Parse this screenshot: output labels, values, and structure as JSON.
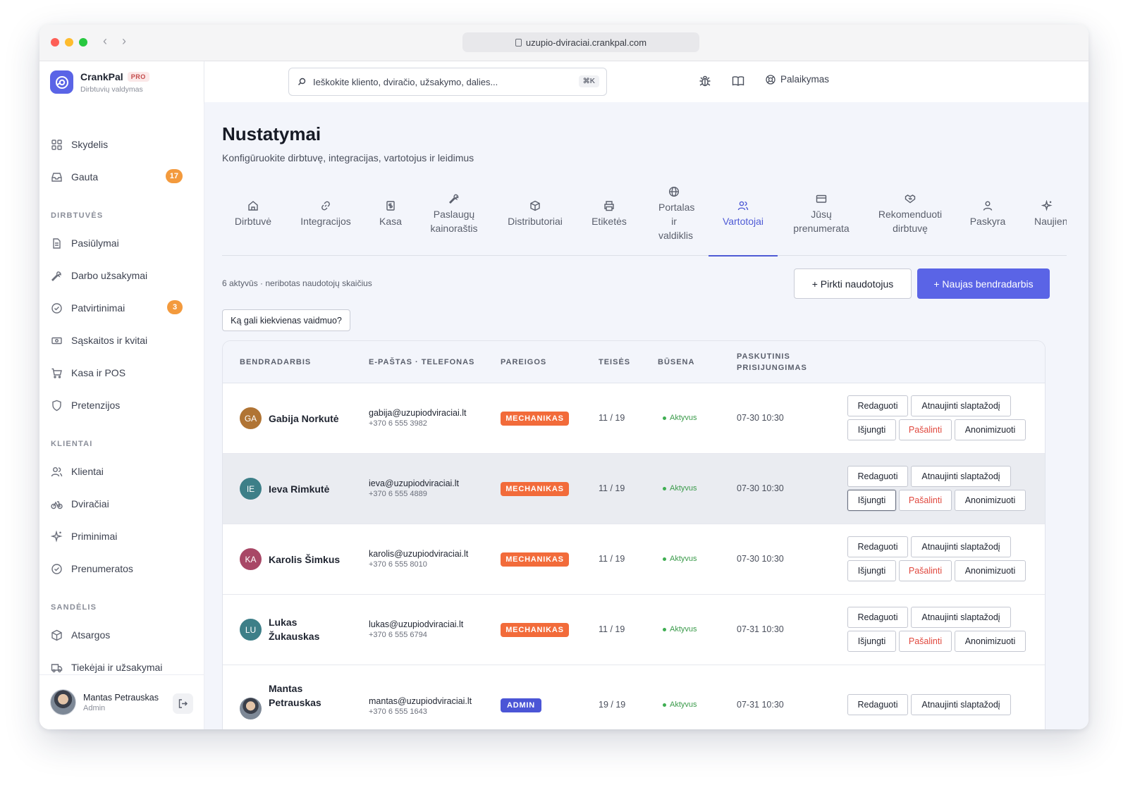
{
  "browser": {
    "url": "uzupio-dviraciai.crankpal.com"
  },
  "brand": {
    "name": "CrankPal",
    "badge": "PRO",
    "subtitle": "Dirbtuvių valdymas"
  },
  "sidebar": {
    "top": [
      {
        "label": "Skydelis",
        "icon": "grid-icon"
      },
      {
        "label": "Gauta",
        "icon": "inbox-icon",
        "badge": "17"
      }
    ],
    "sections": [
      {
        "title": "DIRBTUVĖS",
        "items": [
          {
            "label": "Pasiūlymai",
            "icon": "document-icon"
          },
          {
            "label": "Darbo užsakymai",
            "icon": "wrench-icon"
          },
          {
            "label": "Patvirtinimai",
            "icon": "check-circle-icon",
            "badge": "3"
          },
          {
            "label": "Sąskaitos ir kvitai",
            "icon": "cash-icon"
          },
          {
            "label": "Kasa ir POS",
            "icon": "cart-icon"
          },
          {
            "label": "Pretenzijos",
            "icon": "shield-icon"
          }
        ]
      },
      {
        "title": "KLIENTAI",
        "items": [
          {
            "label": "Klientai",
            "icon": "users-icon"
          },
          {
            "label": "Dviračiai",
            "icon": "bike-icon"
          },
          {
            "label": "Priminimai",
            "icon": "sparkle-icon"
          },
          {
            "label": "Prenumeratos",
            "icon": "check-circle-icon"
          }
        ]
      },
      {
        "title": "SANDĖLIS",
        "items": [
          {
            "label": "Atsargos",
            "icon": "box-icon"
          },
          {
            "label": "Tiekėjai ir užsakymai",
            "icon": "truck-icon"
          }
        ]
      }
    ],
    "user": {
      "name": "Mantas Petrauskas",
      "role": "Admin"
    }
  },
  "topbar": {
    "search_placeholder": "Ieškokite kliento, dviračio, užsakymo, dalies...",
    "search_shortcut": "⌘K",
    "support_label": "Palaikymas"
  },
  "page": {
    "title": "Nustatymai",
    "subtitle": "Konfigūruokite dirbtuvę, integracijas, vartotojus ir leidimus",
    "tabs": [
      {
        "label": "Dirbtuvė",
        "icon": "home-icon"
      },
      {
        "label": "Integracijos",
        "icon": "link-icon"
      },
      {
        "label": "Kasa",
        "icon": "receipt-icon"
      },
      {
        "label": "Paslaugų kainoraštis",
        "icon": "wrench-icon"
      },
      {
        "label": "Distributoriai",
        "icon": "box-icon"
      },
      {
        "label": "Etiketės",
        "icon": "printer-icon"
      },
      {
        "label": "Portalas ir valdiklis",
        "icon": "globe-icon"
      },
      {
        "label": "Vartotojai",
        "icon": "users-icon",
        "active": true
      },
      {
        "label": "Jūsų prenumerata",
        "icon": "card-icon"
      },
      {
        "label": "Rekomenduoti dirbtuvę",
        "icon": "handshake-icon"
      },
      {
        "label": "Paskyra",
        "icon": "user-icon"
      },
      {
        "label": "Naujien",
        "icon": "sparkle-icon"
      }
    ],
    "users_summary": "6 aktyvūs · neribotas naudotojų skaičius",
    "buy_users_label": "+ Pirkti naudotojus",
    "new_collaborator_label": "+ Naujas bendradarbis",
    "roles_help_label": "Ką gali kiekvienas vaidmuo?"
  },
  "table": {
    "columns": [
      "BENDRADARBIS",
      "E-PAŠTAS · TELEFONAS",
      "PAREIGOS",
      "TEISĖS",
      "BŪSENA",
      "PASKUTINIS PRISIJUNGIMAS"
    ],
    "actions": {
      "edit": "Redaguoti",
      "reset_password": "Atnaujinti slaptažodį",
      "disable": "Išjungti",
      "remove": "Pašalinti",
      "anonymize": "Anonimizuoti"
    },
    "rows": [
      {
        "initials": "GA",
        "avatar_color": "#b07434",
        "name": "Gabija Norkutė",
        "email": "gabija@uzupiodviraciai.lt",
        "phone": "+370 6 555 3982",
        "role": "MECHANIKAS",
        "role_color": "#f26b3a",
        "permissions": "11 / 19",
        "status": "Aktyvus",
        "last_login": "07-30 10:30"
      },
      {
        "initials": "IE",
        "avatar_color": "#3d7f88",
        "name": "Ieva Rimkutė",
        "email": "ieva@uzupiodviraciai.lt",
        "phone": "+370 6 555 4889",
        "role": "MECHANIKAS",
        "role_color": "#f26b3a",
        "permissions": "11 / 19",
        "status": "Aktyvus",
        "last_login": "07-30 10:30"
      },
      {
        "initials": "KA",
        "avatar_color": "#a84766",
        "name": "Karolis Šimkus",
        "email": "karolis@uzupiodviraciai.lt",
        "phone": "+370 6 555 8010",
        "role": "MECHANIKAS",
        "role_color": "#f26b3a",
        "permissions": "11 / 19",
        "status": "Aktyvus",
        "last_login": "07-30 10:30"
      },
      {
        "initials": "LU",
        "avatar_color": "#3d7f88",
        "name": "Lukas Žukauskas",
        "email": "lukas@uzupiodviraciai.lt",
        "phone": "+370 6 555 6794",
        "role": "MECHANIKAS",
        "role_color": "#f26b3a",
        "permissions": "11 / 19",
        "status": "Aktyvus",
        "last_login": "07-31 10:30"
      },
      {
        "initials": "",
        "avatar_color": "#6b7583",
        "name": "Mantas Petrauskas",
        "email": "mantas@uzupiodviraciai.lt",
        "phone": "+370 6 555 1643",
        "role": "ADMIN",
        "role_color": "#4b55d6",
        "permissions": "19 / 19",
        "status": "Aktyvus",
        "last_login": "07-31 10:30"
      }
    ]
  },
  "colors": {
    "accent": "#5a64e6",
    "mechanic": "#f26b3a",
    "admin": "#4b55d6",
    "active": "#3fae52",
    "danger": "#e0483e"
  }
}
